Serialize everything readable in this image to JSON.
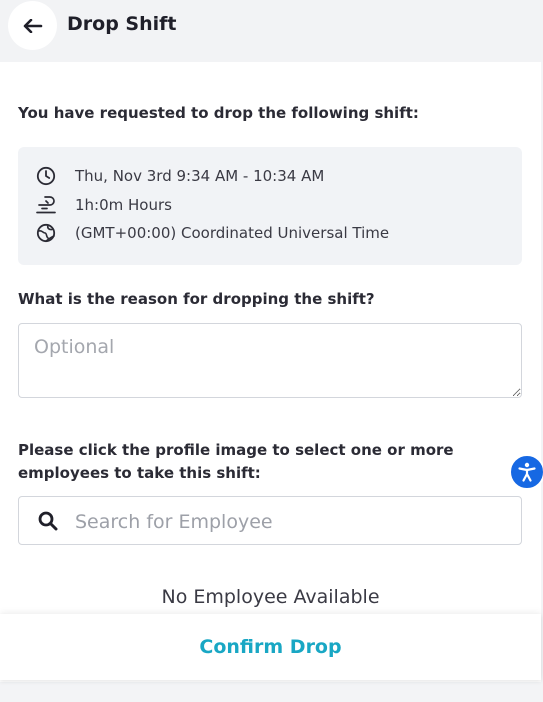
{
  "header": {
    "title": "Drop Shift",
    "back_icon": "arrow-left-icon"
  },
  "intro": {
    "text": "You have requested to drop the following shift:"
  },
  "shift": {
    "datetime": "Thu, Nov 3rd 9:34 AM - 10:34 AM",
    "duration": "1h:0m Hours",
    "timezone": "(GMT+00:00) Coordinated Universal Time"
  },
  "reason": {
    "question": "What is the reason for dropping the shift?",
    "placeholder": "Optional",
    "value": ""
  },
  "employees": {
    "instruction": "Please click the profile image to select one or more employees to take this shift:",
    "search_placeholder": "Search for Employee",
    "empty_message": "No Employee Available"
  },
  "footer": {
    "confirm_label": "Confirm Drop"
  },
  "colors": {
    "accent": "#19a7c4",
    "accessibility": "#1668e3"
  }
}
